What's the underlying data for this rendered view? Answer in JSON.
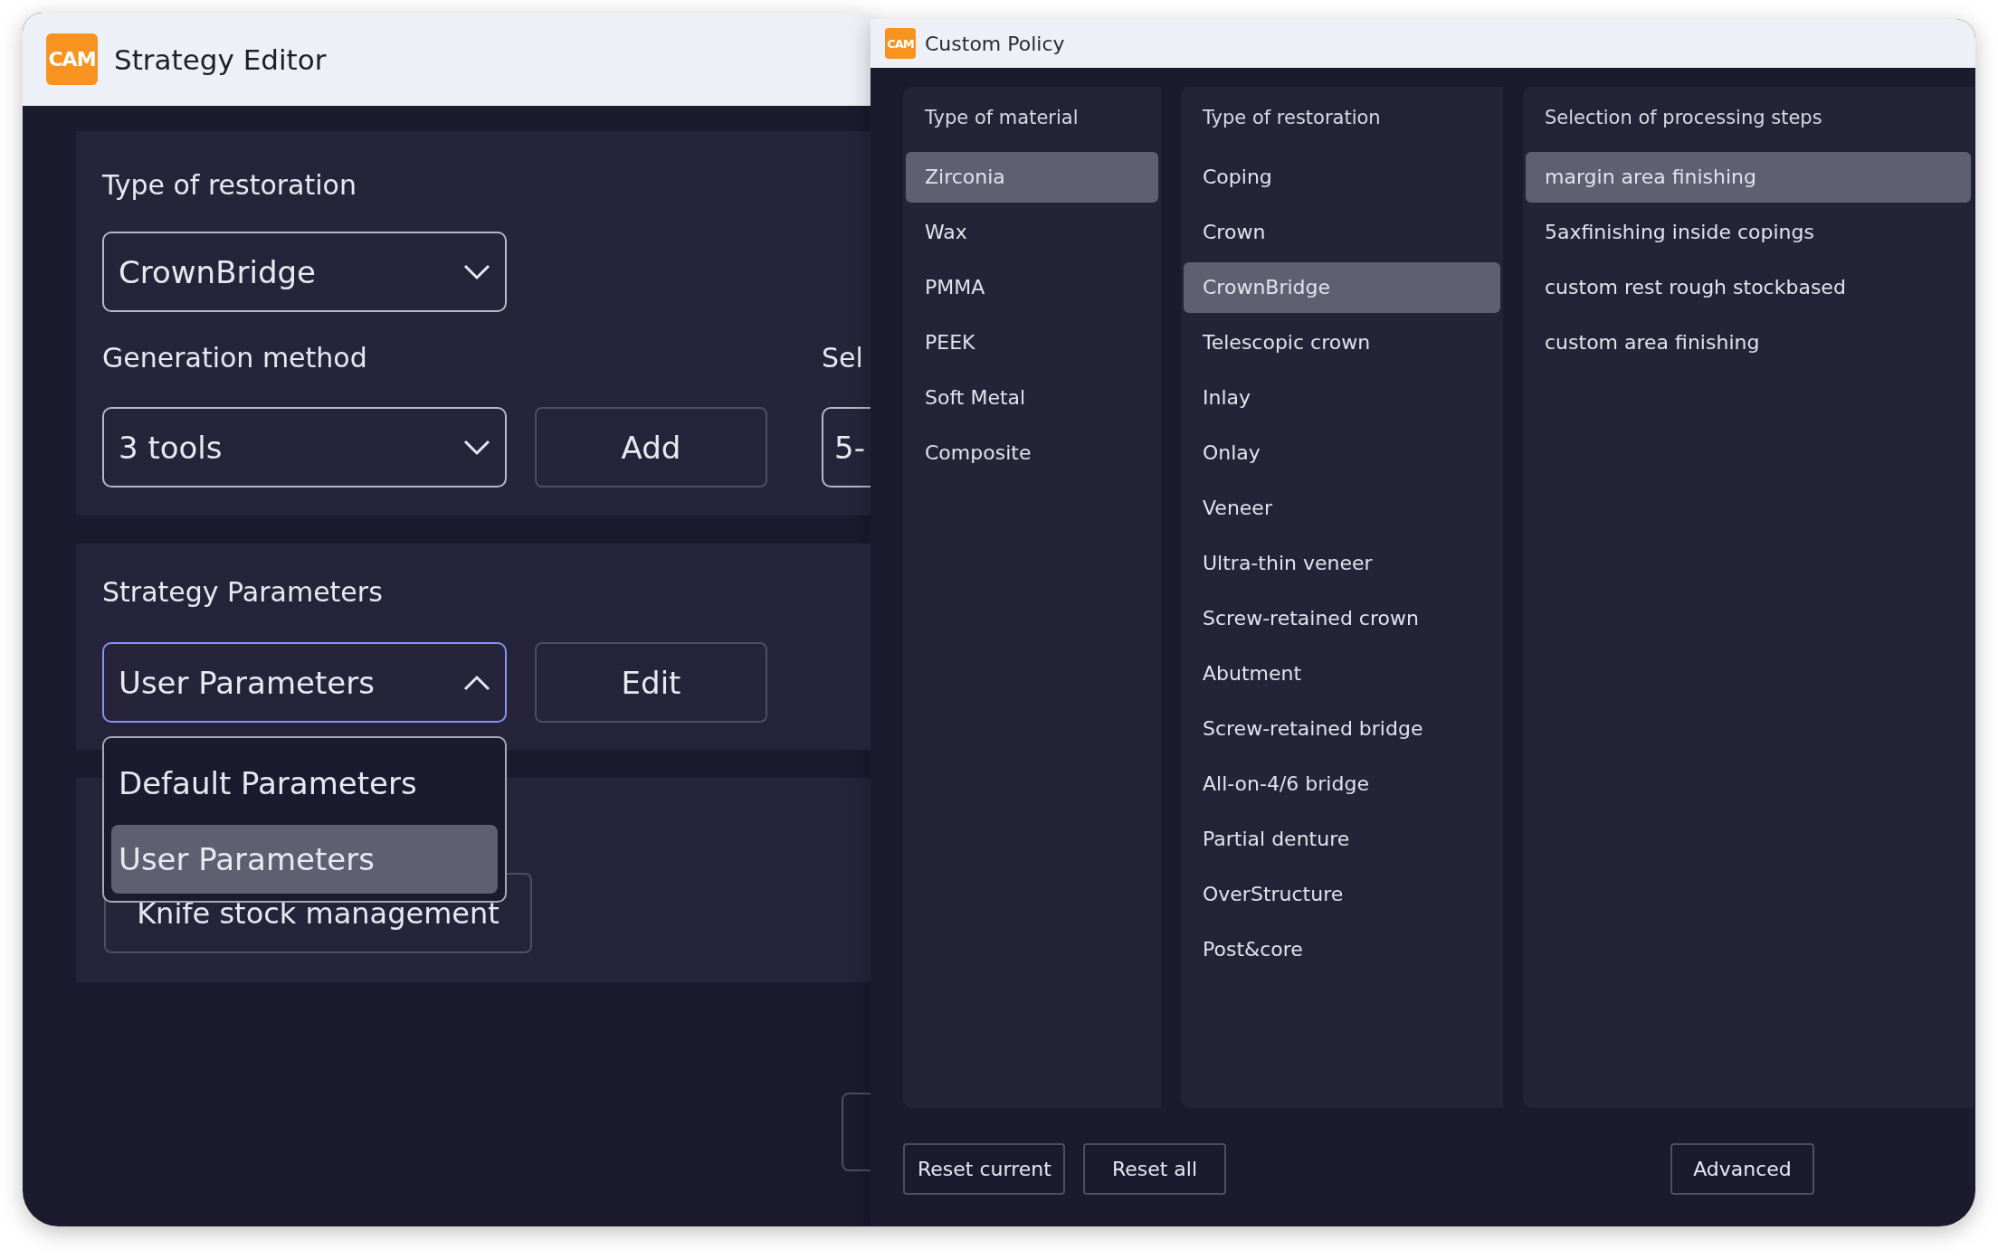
{
  "strategy_editor": {
    "logo": "CAM",
    "title": "Strategy Editor",
    "restoration": {
      "label": "Type of restoration",
      "value": "CrownBridge",
      "open": false
    },
    "generation": {
      "label": "Generation method",
      "value": "3 tools",
      "open": false,
      "button": "Add"
    },
    "selection": {
      "label": "Sel",
      "value": "5-"
    },
    "parameters": {
      "label": "Strategy Parameters",
      "value": "User Parameters",
      "open": true,
      "button": "Edit",
      "options": [
        {
          "label": "Default Parameters",
          "selected": false
        },
        {
          "label": "User Parameters",
          "selected": true
        }
      ]
    },
    "knife_button": "Knife stock management"
  },
  "custom_policy": {
    "logo": "CAM",
    "title": "Custom Policy",
    "columns": [
      {
        "heading": "Type of material",
        "items": [
          {
            "label": "Zirconia",
            "selected": true
          },
          {
            "label": "Wax",
            "selected": false
          },
          {
            "label": "PMMA",
            "selected": false
          },
          {
            "label": "PEEK",
            "selected": false
          },
          {
            "label": "Soft Metal",
            "selected": false
          },
          {
            "label": "Composite",
            "selected": false
          }
        ]
      },
      {
        "heading": "Type of restoration",
        "items": [
          {
            "label": "Coping",
            "selected": false
          },
          {
            "label": "Crown",
            "selected": false
          },
          {
            "label": "CrownBridge",
            "selected": true
          },
          {
            "label": "Telescopic crown",
            "selected": false
          },
          {
            "label": "Inlay",
            "selected": false
          },
          {
            "label": "Onlay",
            "selected": false
          },
          {
            "label": "Veneer",
            "selected": false
          },
          {
            "label": "Ultra-thin veneer",
            "selected": false
          },
          {
            "label": "Screw-retained crown",
            "selected": false
          },
          {
            "label": "Abutment",
            "selected": false
          },
          {
            "label": "Screw-retained bridge",
            "selected": false
          },
          {
            "label": "All-on-4/6 bridge",
            "selected": false
          },
          {
            "label": "Partial denture",
            "selected": false
          },
          {
            "label": "OverStructure",
            "selected": false
          },
          {
            "label": "Post&core",
            "selected": false
          }
        ]
      },
      {
        "heading": "Selection of processing steps",
        "items": [
          {
            "label": "margin area finishing",
            "selected": true
          },
          {
            "label": "5axfinishing inside copings",
            "selected": false
          },
          {
            "label": "custom rest rough stockbased",
            "selected": false
          },
          {
            "label": "custom area finishing",
            "selected": false
          }
        ]
      }
    ],
    "buttons": [
      "Reset current",
      "Reset all"
    ],
    "advanced_button": "Advanced"
  }
}
